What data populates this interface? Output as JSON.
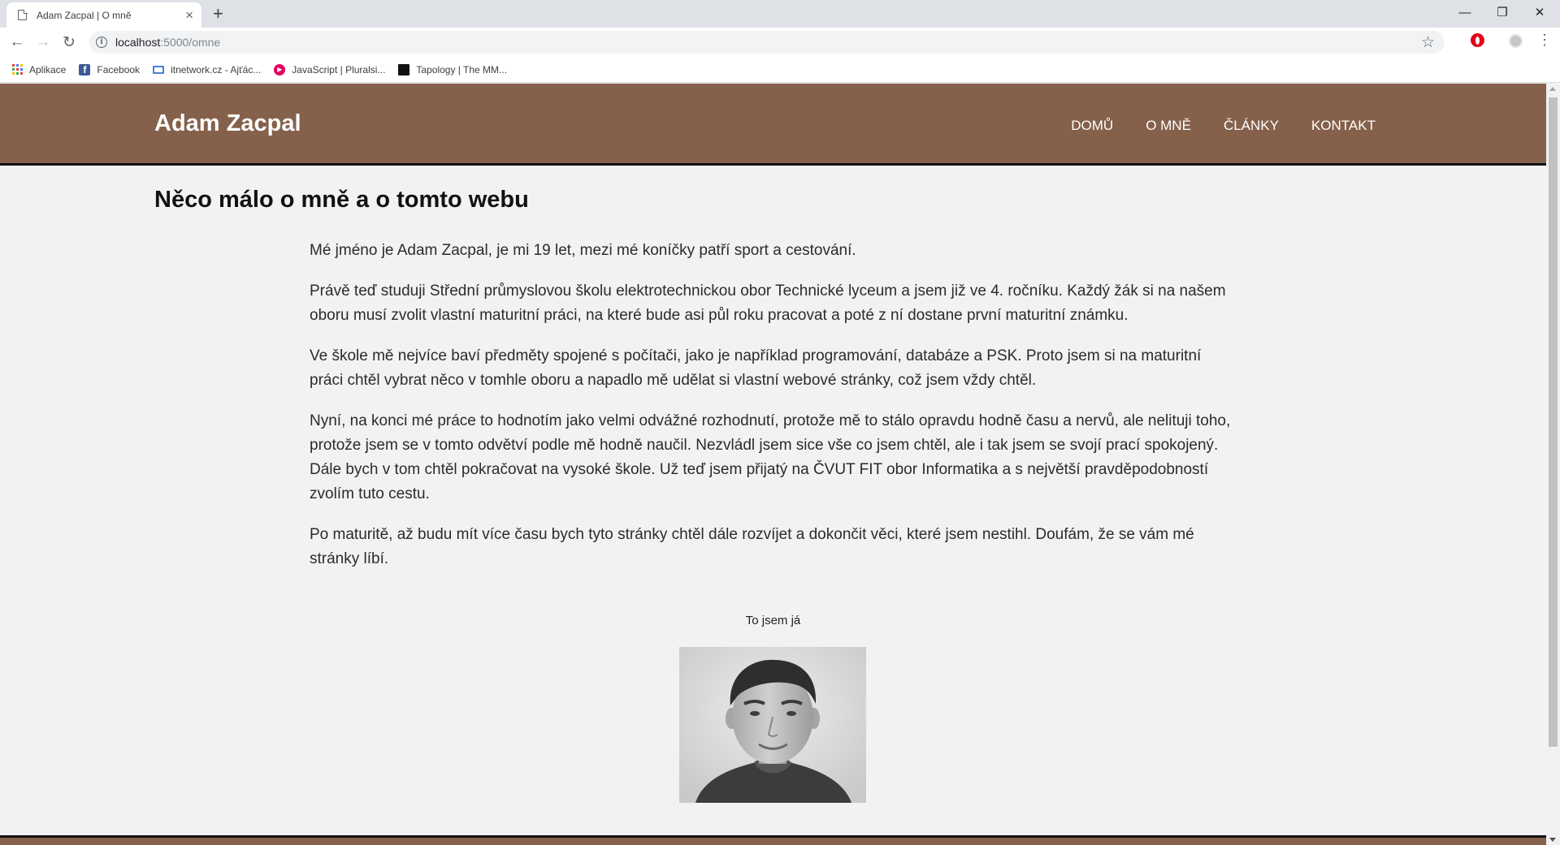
{
  "browser": {
    "tab_title": "Adam Zacpal | O mně",
    "tab_close": "×",
    "new_tab": "+",
    "window_controls": {
      "minimize": "—",
      "restore": "❐",
      "close": "✕"
    },
    "nav": {
      "back": "←",
      "forward": "→",
      "reload": "↻"
    },
    "url_host": "localhost",
    "url_path": ":5000/omne",
    "star_icon": "☆",
    "menu_icon": "⋮",
    "bookmarks": [
      {
        "label": "Aplikace",
        "icon": "apps-grid-icon"
      },
      {
        "label": "Facebook",
        "icon": "facebook-icon"
      },
      {
        "label": "itnetwork.cz - Ajťác...",
        "icon": "laptop-icon"
      },
      {
        "label": "JavaScript | Pluralsi...",
        "icon": "pluralsight-icon"
      },
      {
        "label": "Tapology | The MM...",
        "icon": "tapology-icon"
      }
    ]
  },
  "site": {
    "logo": "Adam Zacpal",
    "nav": [
      "DOMŮ",
      "O MNĚ",
      "ČLÁNKY",
      "KONTAKT"
    ],
    "colors": {
      "header": "#85604a",
      "page_bg": "#f2f2f2"
    }
  },
  "main": {
    "title": "Něco málo o mně a o tomto webu",
    "paragraphs": [
      "Mé jméno je Adam Zacpal, je mi 19 let, mezi mé koníčky patří sport a cestování.",
      "Právě teď studuji Střední průmyslovou školu elektrotechnickou obor Technické lyceum a jsem již ve 4. ročníku. Každý žák si na našem oboru musí zvolit vlastní maturitní práci, na které bude asi půl roku pracovat a poté z ní dostane první maturitní známku.",
      "Ve škole mě nejvíce baví předměty spojené s počítači, jako je například programování, databáze a PSK. Proto jsem si na maturitní práci chtěl vybrat něco v tomhle oboru a napadlo mě udělat si vlastní webové stránky, což jsem vždy chtěl.",
      "Nyní, na konci mé práce to hodnotím jako velmi odvážné rozhodnutí, protože mě to stálo opravdu hodně času a nervů, ale nelituji toho, protože jsem se v tomto odvětví podle mě hodně naučil. Nezvládl jsem sice vše co jsem chtěl, ale i tak jsem se svojí prací spokojený. Dále bych v tom chtěl pokračovat na vysoké škole. Už teď jsem přijatý na ČVUT FIT obor Informatika a s největší pravděpodobností zvolím tuto cestu.",
      "Po maturitě, až budu mít více času bych tyto stránky chtěl dále rozvíjet a dokončit věci, které jsem nestihl. Doufám, že se vám mé stránky líbí."
    ],
    "photo_caption": "To jsem já"
  }
}
